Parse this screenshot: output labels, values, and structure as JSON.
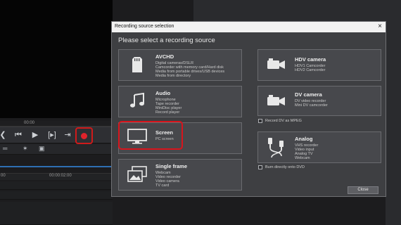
{
  "editor": {
    "ruler_time": "00:00",
    "timeline_labels": [
      "00",
      "00:00:02:00"
    ]
  },
  "dialog": {
    "title": "Recording source selection",
    "close_glyph": "×",
    "heading": "Please select a recording source",
    "close_button": "Close"
  },
  "sources_left": [
    {
      "title": "AVCHD",
      "lines": [
        "Digital cameras/DSLR",
        "Camcorder with memory card/Hard disk",
        "Media from portable drives/USB devices",
        "Media from directory"
      ]
    },
    {
      "title": "Audio",
      "lines": [
        "Microphone",
        "Tape recorder",
        "MiniDisc player",
        "Record player"
      ]
    },
    {
      "title": "Screen",
      "lines": [
        "PC screen"
      ]
    },
    {
      "title": "Single frame",
      "lines": [
        "Webcam",
        "Video recorder",
        "Video camera",
        "TV card"
      ]
    }
  ],
  "sources_right": [
    {
      "title": "HDV camera",
      "lines": [
        "HDV1 Camcorder",
        "HDV2 Camcorder"
      ]
    },
    {
      "title": "DV camera",
      "lines": [
        "DV video recorder",
        "Mini DV camcorder"
      ]
    },
    {
      "title": "Analog",
      "lines": [
        "VHS recorder",
        "Video input",
        "Analog TV",
        "Webcam"
      ]
    }
  ],
  "options": {
    "record_dv_mpeg": "Record DV as MPEG",
    "burn_dvd": "Burn directly onto DVD"
  },
  "colors": {
    "highlight": "#d8141c",
    "record": "#e0232b",
    "dialog_bg": "#3e3f42"
  }
}
